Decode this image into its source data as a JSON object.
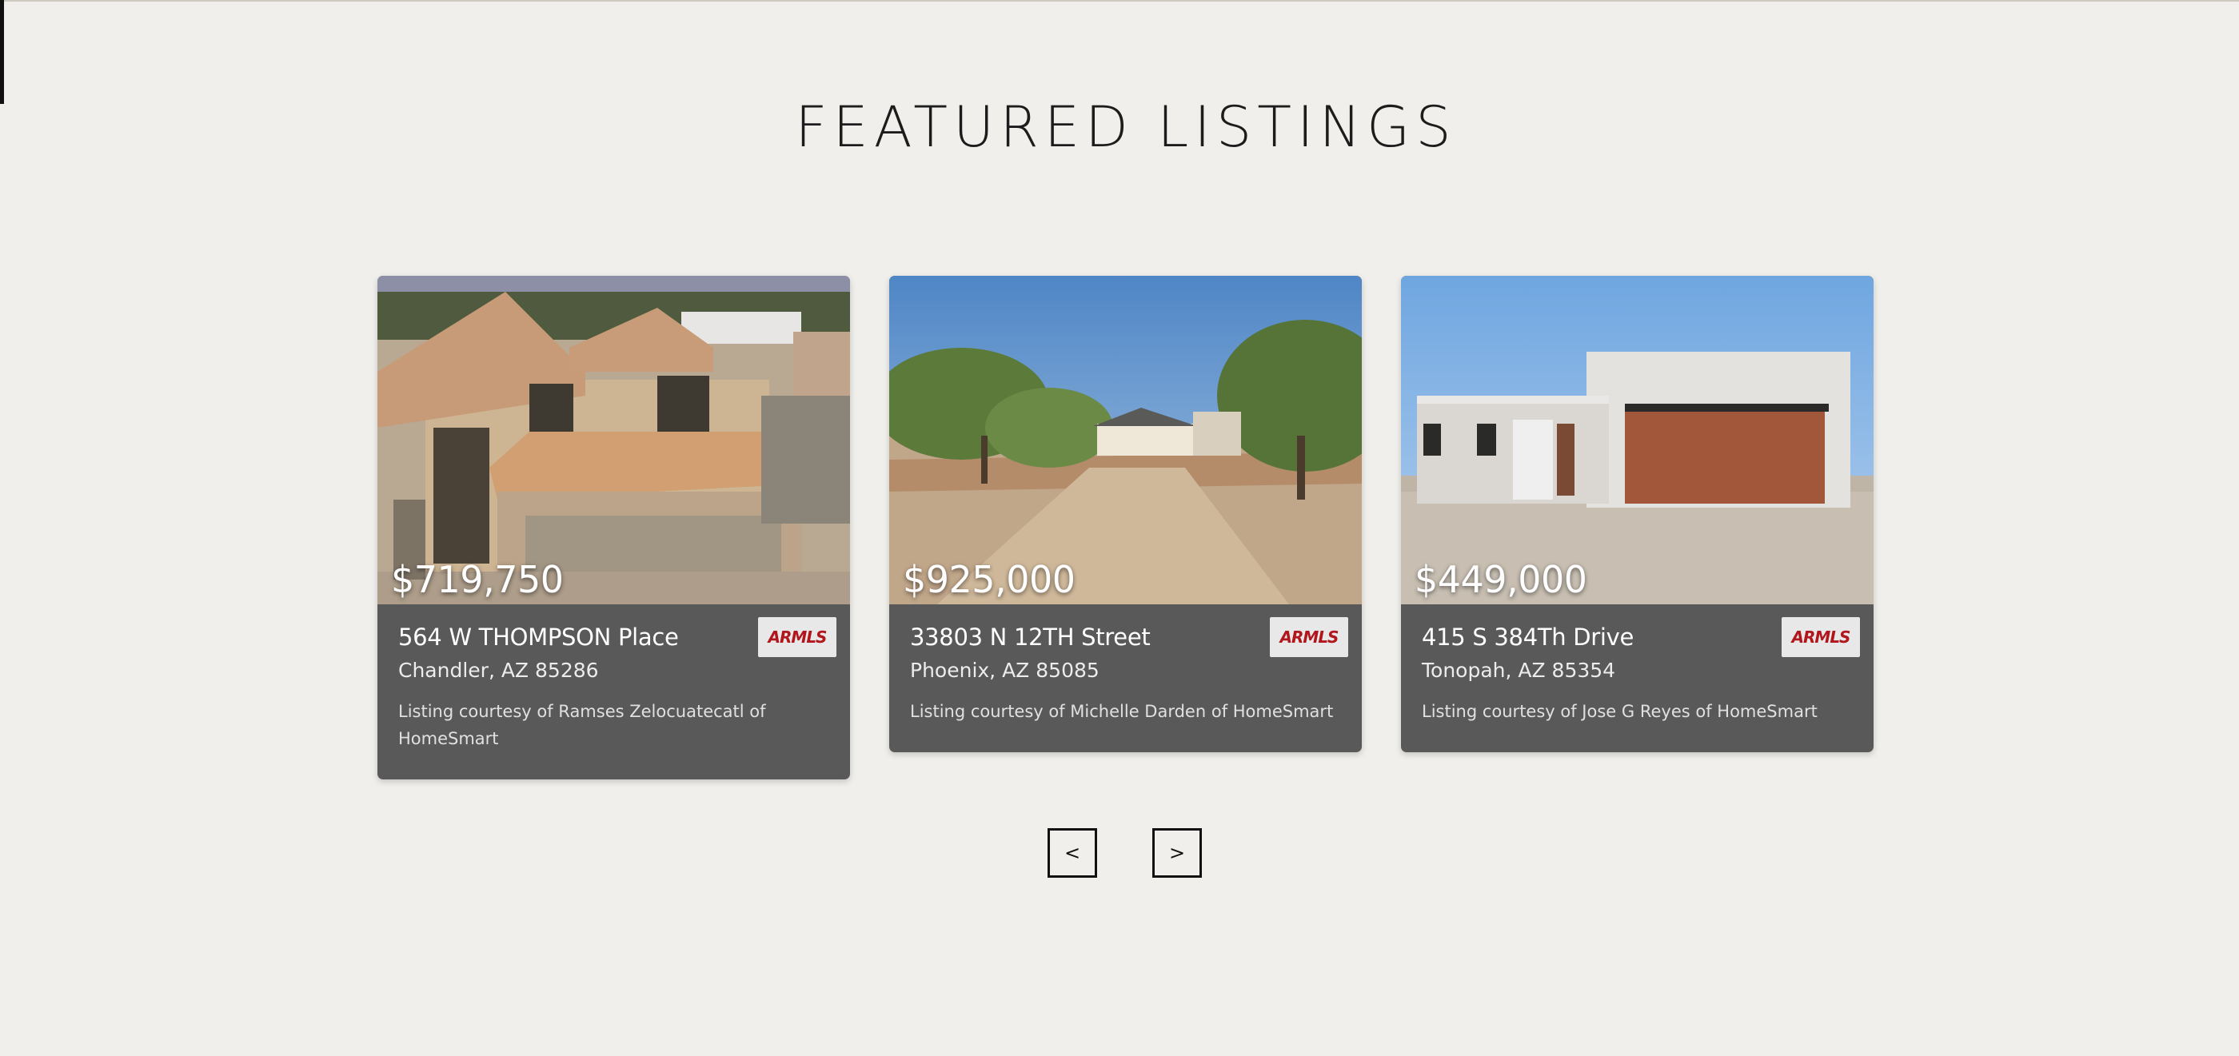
{
  "section": {
    "title": "FEATURED LISTINGS"
  },
  "listings": [
    {
      "price": "$719,750",
      "street": "564 W THOMPSON Place",
      "city": "Chandler, AZ 85286",
      "courtesy": "Listing courtesy of Ramses Zelocuatecatl of HomeSmart",
      "logo": "ARMLS"
    },
    {
      "price": "$925,000",
      "street": "33803 N 12TH Street",
      "city": "Phoenix, AZ 85085",
      "courtesy": "Listing courtesy of Michelle Darden of HomeSmart",
      "logo": "ARMLS"
    },
    {
      "price": "$449,000",
      "street": "415 S 384Th Drive",
      "city": "Tonopah, AZ 85354",
      "courtesy": "Listing courtesy of Jose G Reyes of HomeSmart",
      "logo": "ARMLS"
    }
  ],
  "carousel": {
    "prev_label": "<",
    "next_label": ">"
  },
  "colors": {
    "background": "#f0efeb",
    "card": "#595959",
    "logo_red": "#b0161c"
  }
}
